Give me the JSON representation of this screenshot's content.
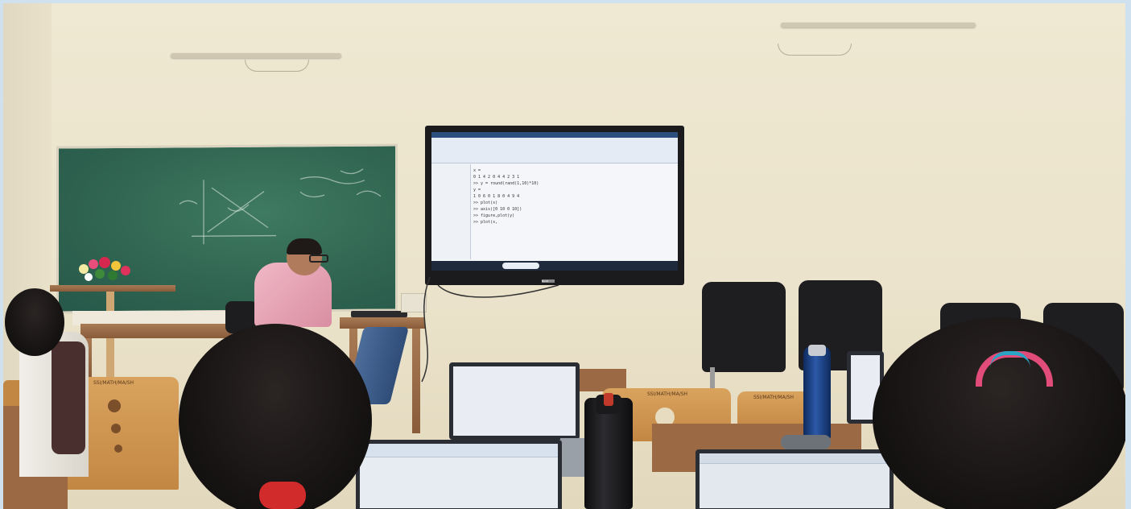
{
  "scene": {
    "description_tag": "classroom-photo"
  },
  "screen": {
    "lines": [
      "x =",
      "  0  1  4  2  0  4  4  2  3  1",
      ">> y = round(rand(1,10)*10)",
      "y =",
      "  1  0  6  0  1  8  0  4  9  4",
      ">> plot(x)",
      ">> axis([0 10 0 10])",
      ">> figure,plot(y)",
      ">> plot(x,"
    ]
  },
  "monitor": {
    "brand": "BenQ"
  },
  "chair_labels": {
    "left": "SSI/MATH/MA/SH",
    "middle": "SSI/MATH/MA/SH",
    "right": "SSI/MATH/MA/SH"
  },
  "colors": {
    "wall": "#ebe3cb",
    "board": "#2f6450",
    "monitor_bezel": "#1b1b1d",
    "shirt": "#e6a6b8",
    "hair_clip": "#d12b2b"
  }
}
